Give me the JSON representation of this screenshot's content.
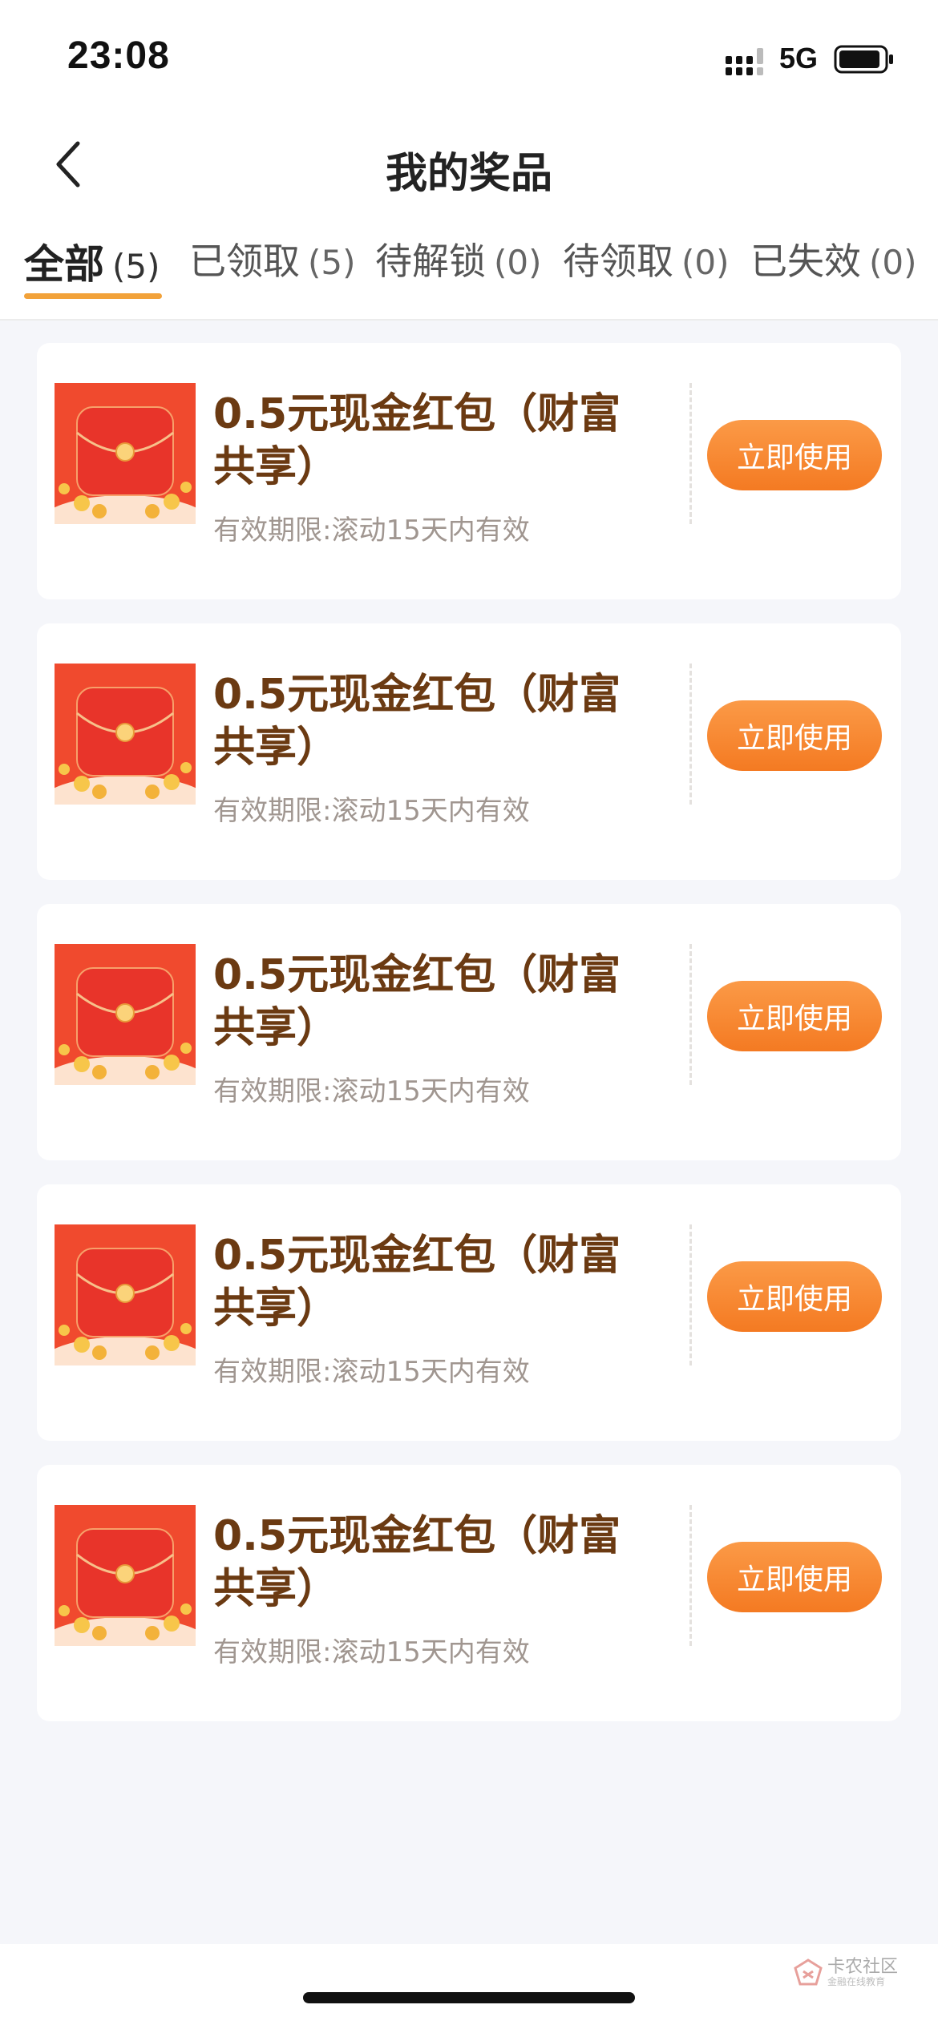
{
  "status_bar": {
    "time": "23:08",
    "network": "5G",
    "icons": [
      "signal-icon",
      "battery-icon"
    ]
  },
  "nav": {
    "title": "我的奖品",
    "back_icon": "chevron-left-icon"
  },
  "tabs": [
    {
      "label": "全部",
      "count": "(5)",
      "active": true
    },
    {
      "label": "已领取",
      "count": "(5)",
      "active": false
    },
    {
      "label": "待解锁",
      "count": "(0)",
      "active": false
    },
    {
      "label": "待领取",
      "count": "(0)",
      "active": false
    },
    {
      "label": "已失效",
      "count": "(0)",
      "active": false
    }
  ],
  "prizes": [
    {
      "title": "0.5元现金红包（财富共享）",
      "validity": "有效期限:滚动15天内有效",
      "button": "立即使用",
      "icon": "red-envelope-icon"
    },
    {
      "title": "0.5元现金红包（财富共享）",
      "validity": "有效期限:滚动15天内有效",
      "button": "立即使用",
      "icon": "red-envelope-icon"
    },
    {
      "title": "0.5元现金红包（财富共享）",
      "validity": "有效期限:滚动15天内有效",
      "button": "立即使用",
      "icon": "red-envelope-icon"
    },
    {
      "title": "0.5元现金红包（财富共享）",
      "validity": "有效期限:滚动15天内有效",
      "button": "立即使用",
      "icon": "red-envelope-icon"
    },
    {
      "title": "0.5元现金红包（财富共享）",
      "validity": "有效期限:滚动15天内有效",
      "button": "立即使用",
      "icon": "red-envelope-icon"
    }
  ],
  "watermark": {
    "title": "卡农社区",
    "subtitle": "金融在线教育"
  },
  "colors": {
    "accent": "#f2a23a",
    "button": "#f47a22",
    "title": "#6b3a12",
    "envelope": "#e8342a"
  }
}
